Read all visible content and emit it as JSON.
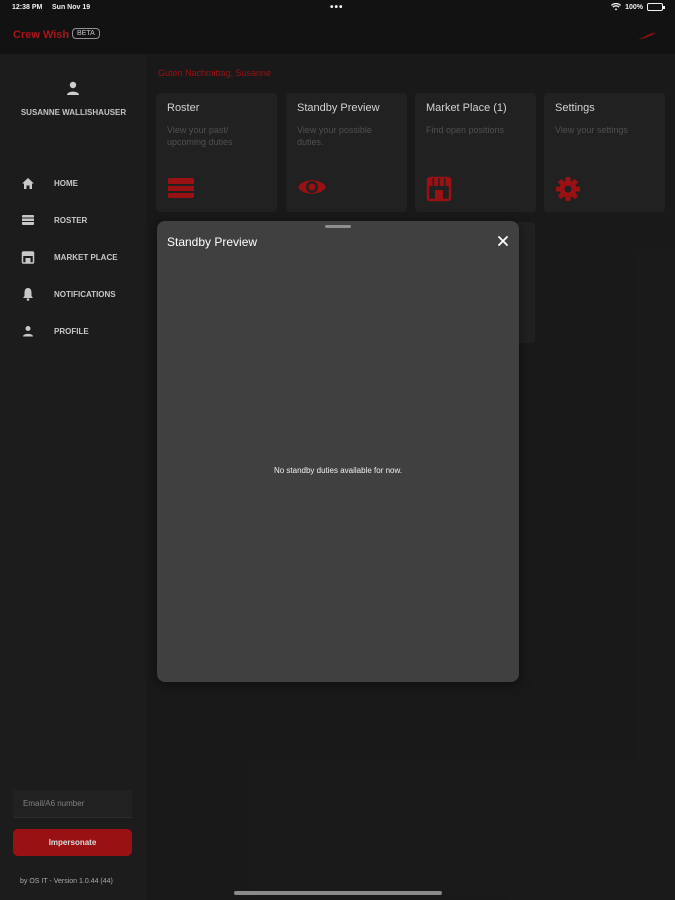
{
  "status_bar": {
    "time": "12:38 PM",
    "date": "Sun Nov 19",
    "battery": "100%"
  },
  "app": {
    "brand": "Crew Wish",
    "badge": "BETA",
    "accent_color": "#a31216"
  },
  "sidebar": {
    "user_name": "SUSANNE WALLISHAUSER",
    "nav": [
      {
        "label": "HOME",
        "icon": "home-icon"
      },
      {
        "label": "ROSTER",
        "icon": "roster-icon"
      },
      {
        "label": "MARKET PLACE",
        "icon": "market-place-icon"
      },
      {
        "label": "NOTIFICATIONS",
        "icon": "bell-icon"
      },
      {
        "label": "PROFILE",
        "icon": "person-icon"
      }
    ],
    "email_placeholder": "Email/A6 number",
    "impersonate_label": "Impersonate",
    "version": "by OS IT - Version 1.0.44 (44)"
  },
  "main": {
    "greeting": "Guten Nachmittag, Susanne",
    "cards": [
      {
        "title": "Roster",
        "description": "View your past/ upcoming duties",
        "icon": "roster-icon"
      },
      {
        "title": "Standby Preview",
        "description": "View your possible duties.",
        "icon": "eye-icon"
      },
      {
        "title": "Market Place (1)",
        "description": "Find open positions",
        "icon": "market-place-icon"
      },
      {
        "title": "Settings",
        "description": "View your settings",
        "icon": "gear-icon"
      }
    ]
  },
  "modal": {
    "title": "Standby Preview",
    "empty_message": "No standby duties available for now."
  }
}
